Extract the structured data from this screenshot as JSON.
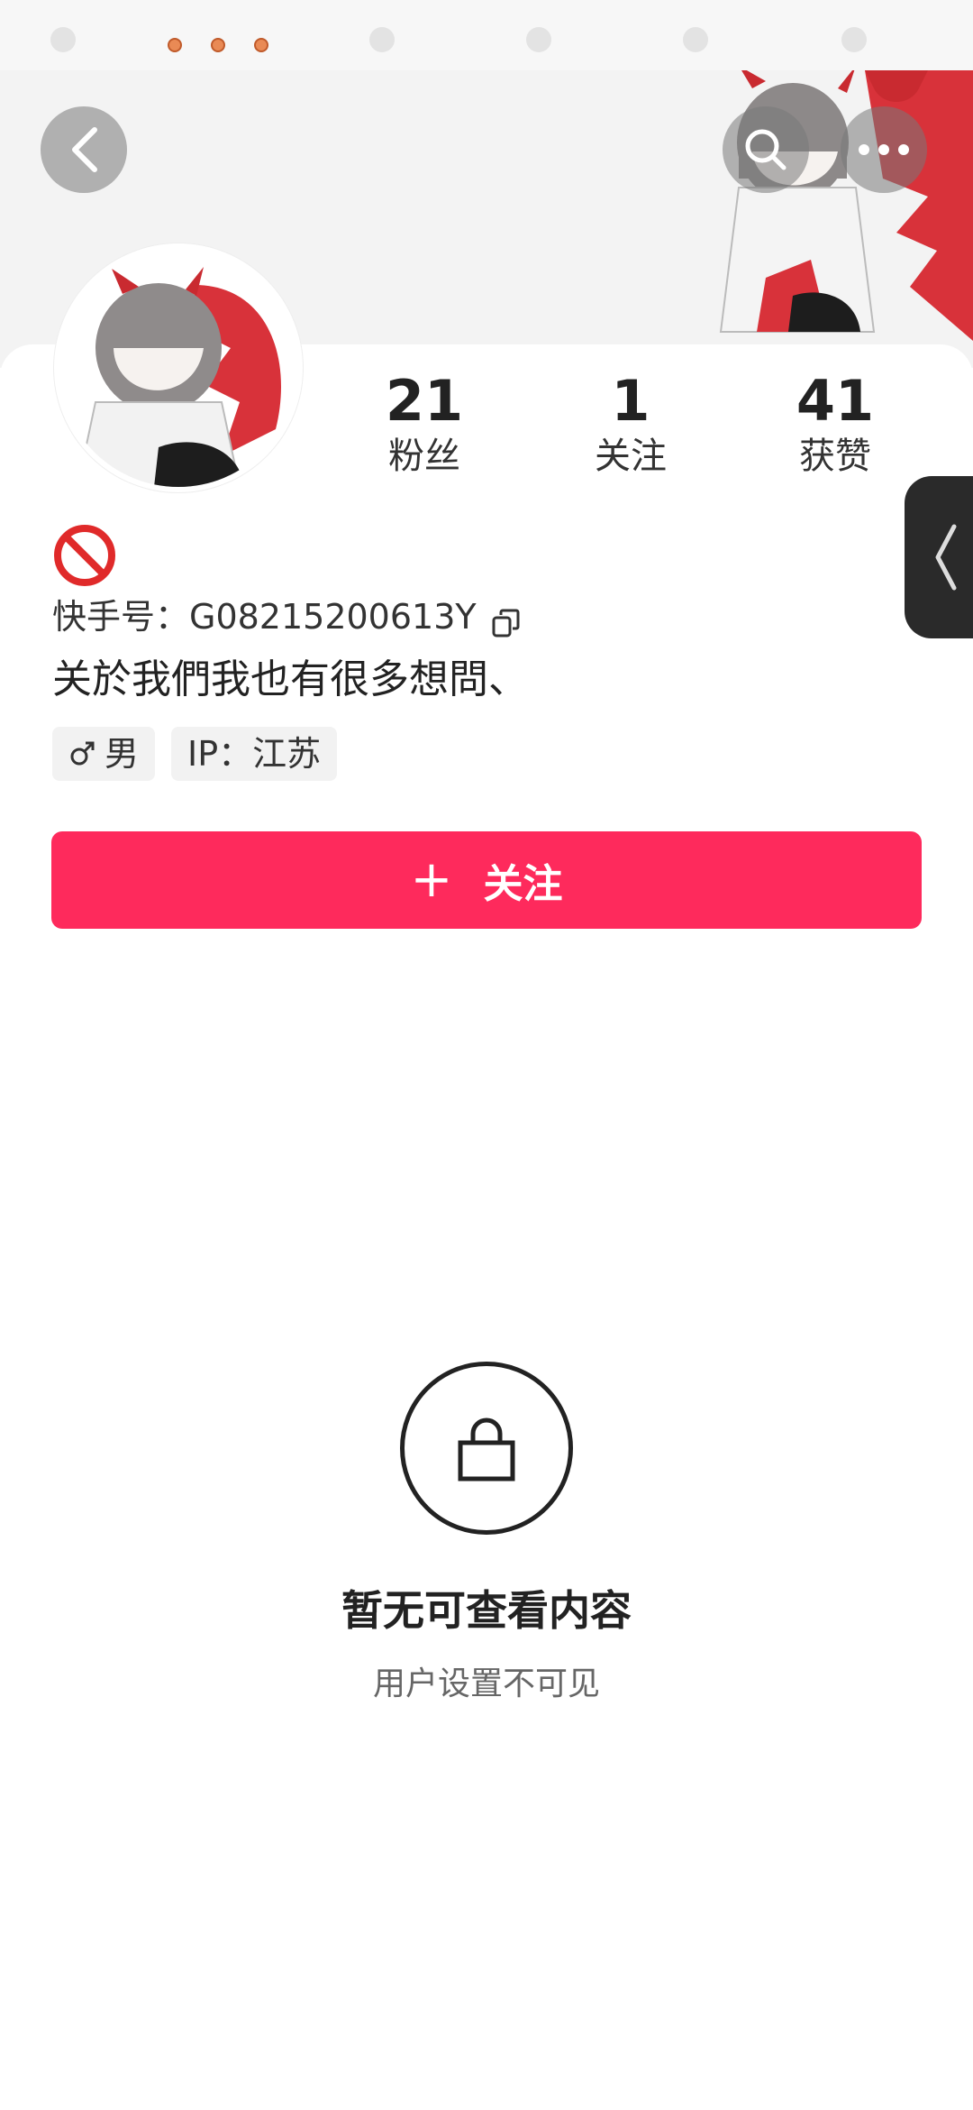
{
  "profile": {
    "kuaishou_id": "快手号：G08215200613Y",
    "bio": "关於我們我也有很多想問、",
    "gender_tag": "男",
    "ip_tag": "IP：江苏"
  },
  "stats": [
    {
      "value": "21",
      "label": "粉丝"
    },
    {
      "value": "1",
      "label": "关注"
    },
    {
      "value": "41",
      "label": "获赞"
    }
  ],
  "actions": {
    "follow_label": "关注"
  },
  "empty_state": {
    "title": "暂无可查看内容",
    "subtitle": "用户设置不可见"
  },
  "colors": {
    "accent": "#fe2a5c",
    "side_tab": "#2a2a2a"
  },
  "icons": [
    "back-icon",
    "search-icon",
    "more-icon",
    "ban-icon",
    "copy-icon",
    "male-icon",
    "plus-icon",
    "lock-icon",
    "chevron-left-icon"
  ]
}
